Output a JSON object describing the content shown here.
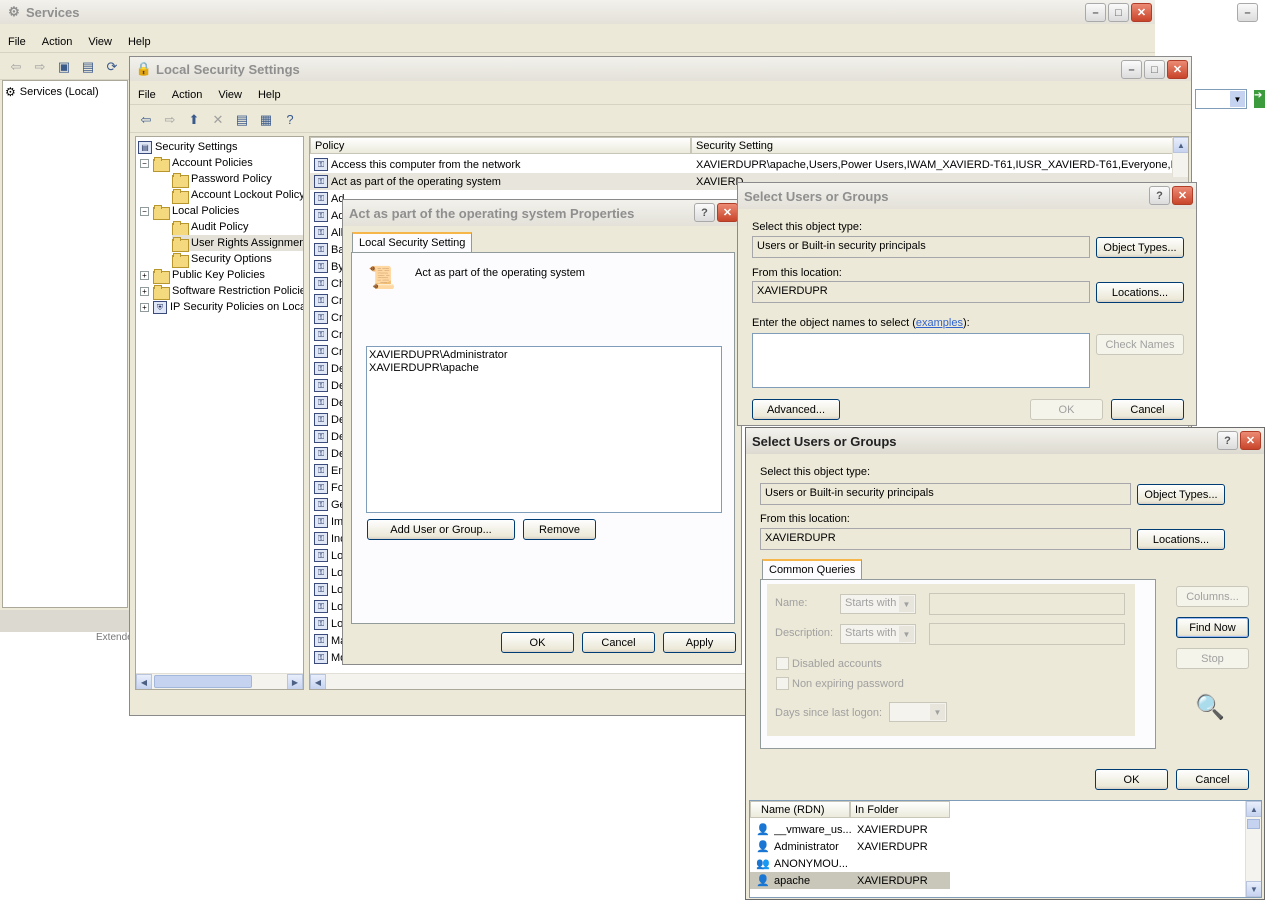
{
  "services": {
    "title": "Services",
    "menu": [
      "File",
      "Action",
      "View",
      "Help"
    ],
    "tree_root": "Services (Local)",
    "partial_node": "Extende"
  },
  "lss": {
    "title": "Local Security Settings",
    "menu": [
      "File",
      "Action",
      "View",
      "Help"
    ],
    "tree": {
      "root": "Security Settings",
      "account_policies": "Account Policies",
      "password_policy": "Password Policy",
      "account_lockout_policy": "Account Lockout Policy",
      "local_policies": "Local Policies",
      "audit_policy": "Audit Policy",
      "user_rights": "User Rights Assignmen",
      "security_options": "Security Options",
      "public_key": "Public Key Policies",
      "software_restriction": "Software Restriction Policie",
      "ip_security": "IP Security Policies on Loca"
    },
    "columns": {
      "policy": "Policy",
      "setting": "Security Setting"
    },
    "rows": [
      {
        "policy": "Access this computer from the network",
        "setting": "XAVIERDUPR\\apache,Users,Power Users,IWAM_XAVIERD-T61,IUSR_XAVIERD-T61,Everyone,B..."
      },
      {
        "policy": "Act as part of the operating system",
        "setting": "XAVIERD..."
      }
    ],
    "row_stubs": [
      "Ad",
      "Ad",
      "All",
      "Ba",
      "By",
      "Ch",
      "Cr",
      "Cr",
      "Cr",
      "Cr",
      "De",
      "De",
      "De",
      "De",
      "De",
      "De",
      "En",
      "Fo",
      "Ge",
      "Im",
      "Inc",
      "Lo",
      "Lo",
      "Lo",
      "Lo",
      "Lo",
      "Ma",
      "Mo"
    ]
  },
  "props": {
    "title": "Act as part of the operating system Properties",
    "tab": "Local Security Setting",
    "heading": "Act as part of the operating system",
    "members": [
      "XAVIERDUPR\\Administrator",
      "XAVIERDUPR\\apache"
    ],
    "add_button": "Add User or Group...",
    "remove_button": "Remove",
    "ok": "OK",
    "cancel": "Cancel",
    "apply": "Apply"
  },
  "select1": {
    "title": "Select Users or Groups",
    "object_type_label": "Select this object type:",
    "object_type": "Users or Built-in security principals",
    "object_types_button": "Object Types...",
    "location_label": "From this location:",
    "location": "XAVIERDUPR",
    "locations_button": "Locations...",
    "enter_label": "Enter the object names to select (",
    "enter_link": "examples",
    "enter_suffix": "):",
    "check_names": "Check Names",
    "advanced": "Advanced...",
    "ok": "OK",
    "cancel": "Cancel"
  },
  "select2": {
    "title": "Select Users or Groups",
    "object_type_label": "Select this object type:",
    "object_type": "Users or Built-in security principals",
    "object_types_button": "Object Types...",
    "location_label": "From this location:",
    "location": "XAVIERDUPR",
    "locations_button": "Locations...",
    "tab": "Common Queries",
    "name_label": "Name:",
    "desc_label": "Description:",
    "starts_with": "Starts with",
    "disabled_accounts": "Disabled accounts",
    "non_expiring": "Non expiring password",
    "days_label": "Days since last logon:",
    "columns_button": "Columns...",
    "find_now": "Find Now",
    "stop": "Stop",
    "ok": "OK",
    "cancel": "Cancel",
    "col_name": "Name (RDN)",
    "col_folder": "In Folder",
    "results": [
      {
        "name": "__vmware_us...",
        "folder": "XAVIERDUPR"
      },
      {
        "name": "Administrator",
        "folder": "XAVIERDUPR"
      },
      {
        "name": "ANONYMOU...",
        "folder": ""
      },
      {
        "name": "apache",
        "folder": "XAVIERDUPR"
      }
    ]
  }
}
